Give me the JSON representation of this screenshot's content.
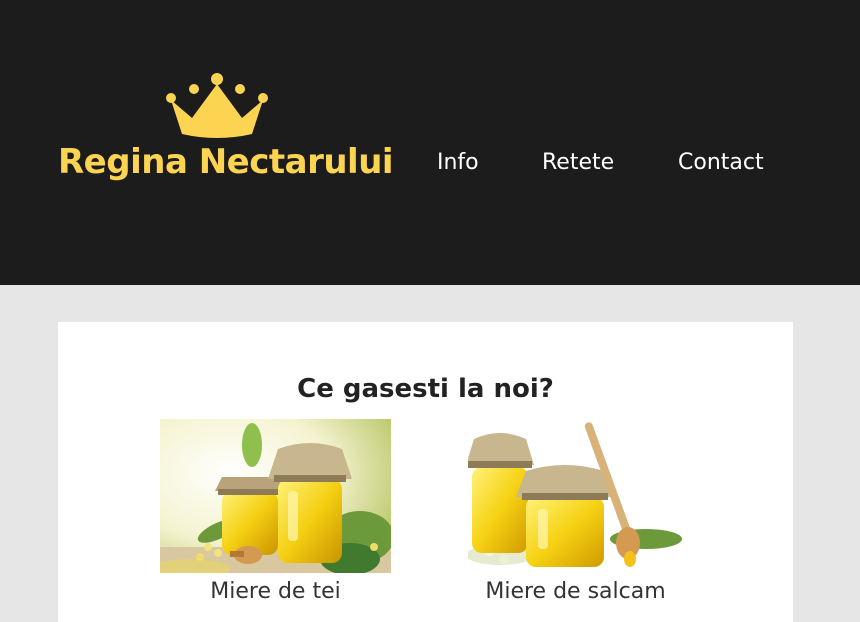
{
  "brand": {
    "name": "Regina Nectarului",
    "icon": "crown-icon",
    "color": "#fdd452"
  },
  "nav": {
    "items": [
      {
        "label": "Info"
      },
      {
        "label": "Retete"
      },
      {
        "label": "Contact"
      }
    ]
  },
  "main": {
    "title": "Ce gasesti la noi?",
    "products": [
      {
        "name": "Miere de tei",
        "image": "honey-jars-linden-image"
      },
      {
        "name": "Miere de salcam",
        "image": "honey-jars-acacia-image"
      }
    ]
  },
  "colors": {
    "header_bg": "#1c1c1c",
    "page_bg": "#e6e6e6",
    "card_bg": "#ffffff",
    "accent": "#fdd452"
  }
}
